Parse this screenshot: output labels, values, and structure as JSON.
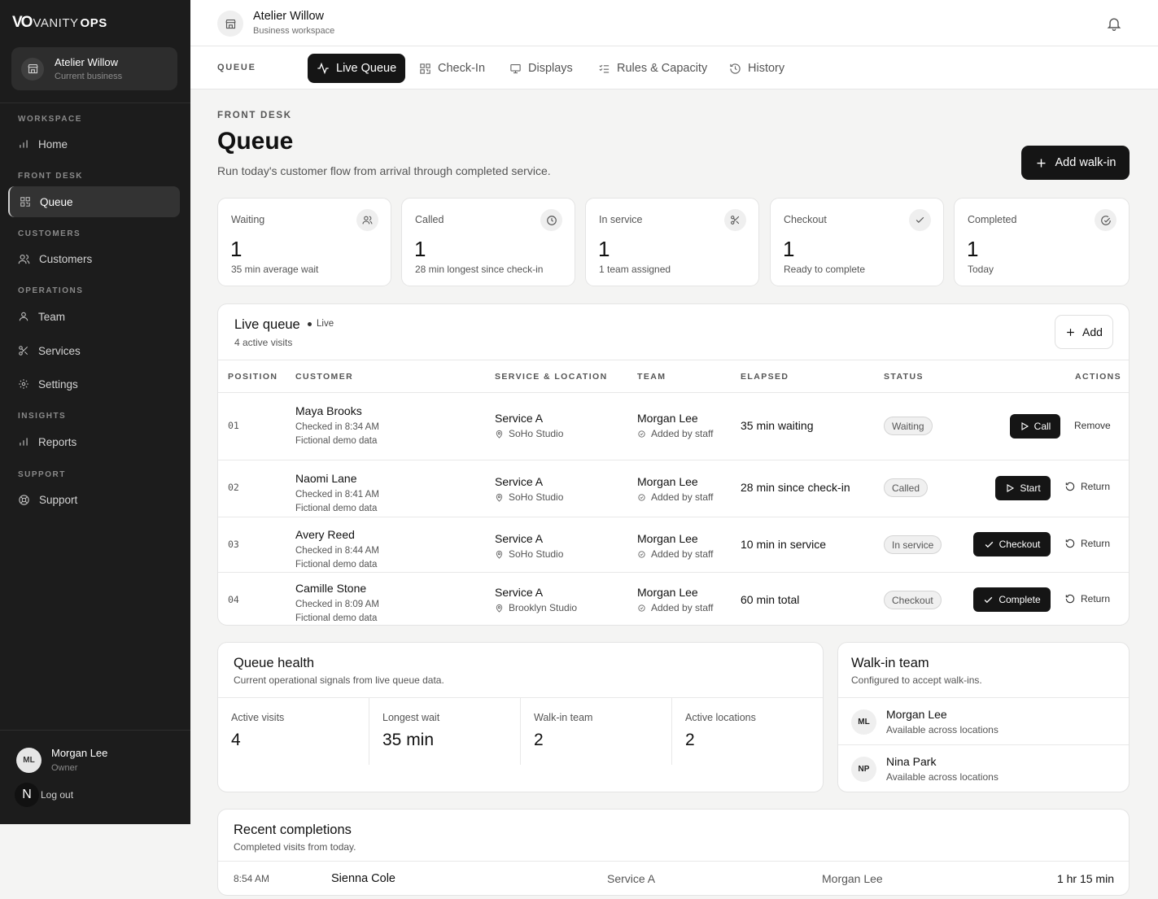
{
  "brand": {
    "logo_mark": "VO",
    "logo_vanity": "VANITY",
    "logo_ops": "OPS"
  },
  "sidebar": {
    "business_name": "Atelier Willow",
    "business_role": "Current business",
    "sections": {
      "workspace": "WORKSPACE",
      "front_desk": "FRONT DESK",
      "customers": "CUSTOMERS",
      "operations": "OPERATIONS",
      "insights": "INSIGHTS",
      "support": "SUPPORT"
    },
    "items": {
      "home": "Home",
      "queue": "Queue",
      "customers": "Customers",
      "team": "Team",
      "services": "Services",
      "settings": "Settings",
      "reports": "Reports",
      "support": "Support"
    },
    "user": {
      "initials": "ML",
      "name": "Morgan Lee",
      "role": "Owner"
    },
    "logout": {
      "badge": "N",
      "label": "Log out"
    }
  },
  "topbar": {
    "title": "Atelier Willow",
    "subtitle": "Business workspace"
  },
  "tabs": {
    "section_label": "QUEUE",
    "items": [
      "Live Queue",
      "Check-In",
      "Displays",
      "Rules & Capacity",
      "History"
    ]
  },
  "page": {
    "kicker": "FRONT DESK",
    "title": "Queue",
    "subtitle": "Run today's customer flow from arrival through completed service.",
    "add_walkin": "Add walk-in"
  },
  "stats": [
    {
      "label": "Waiting",
      "value": "1",
      "sub": "35 min average wait",
      "icon": "users-icon"
    },
    {
      "label": "Called",
      "value": "1",
      "sub": "28 min longest since check-in",
      "icon": "clock-icon"
    },
    {
      "label": "In service",
      "value": "1",
      "sub": "1 team assigned",
      "icon": "scissors-icon"
    },
    {
      "label": "Checkout",
      "value": "1",
      "sub": "Ready to complete",
      "icon": "check-icon"
    },
    {
      "label": "Completed",
      "value": "1",
      "sub": "Today",
      "icon": "check-circle-icon"
    }
  ],
  "live_queue": {
    "title": "Live queue",
    "live": "Live",
    "subtitle": "4 active visits",
    "add_label": "Add",
    "headers": [
      "POSITION",
      "CUSTOMER",
      "SERVICE & LOCATION",
      "TEAM",
      "ELAPSED",
      "STATUS",
      "ACTIONS"
    ],
    "rows": [
      {
        "position": "01",
        "name": "Maya Brooks",
        "checked": "Checked in 8:34 AM",
        "note": "Fictional demo data",
        "service": "Service A",
        "location": "SoHo Studio",
        "team": "Morgan Lee",
        "team_sub": "Added by staff",
        "elapsed": "35 min waiting",
        "status": "Waiting",
        "primary": "Call",
        "secondary": "Remove"
      },
      {
        "position": "02",
        "name": "Naomi Lane",
        "checked": "Checked in 8:41 AM",
        "note": "Fictional demo data",
        "service": "Service A",
        "location": "SoHo Studio",
        "team": "Morgan Lee",
        "team_sub": "Added by staff",
        "elapsed": "28 min since check-in",
        "status": "Called",
        "primary": "Start",
        "secondary": "Return"
      },
      {
        "position": "03",
        "name": "Avery Reed",
        "checked": "Checked in 8:44 AM",
        "note": "Fictional demo data",
        "service": "Service A",
        "location": "SoHo Studio",
        "team": "Morgan Lee",
        "team_sub": "Added by staff",
        "elapsed": "10 min in service",
        "status": "In service",
        "primary": "Checkout",
        "secondary": "Return"
      },
      {
        "position": "04",
        "name": "Camille Stone",
        "checked": "Checked in 8:09 AM",
        "note": "Fictional demo data",
        "service": "Service A",
        "location": "Brooklyn Studio",
        "team": "Morgan Lee",
        "team_sub": "Added by staff",
        "elapsed": "60 min total",
        "status": "Checkout",
        "primary": "Complete",
        "secondary": "Return"
      }
    ]
  },
  "queue_health": {
    "title": "Queue health",
    "subtitle": "Current operational signals from live queue data.",
    "metrics": [
      {
        "label": "Active visits",
        "value": "4"
      },
      {
        "label": "Longest wait",
        "value": "35 min"
      },
      {
        "label": "Walk-in team",
        "value": "2"
      },
      {
        "label": "Active locations",
        "value": "2"
      }
    ]
  },
  "walkin_team": {
    "title": "Walk-in team",
    "subtitle": "Configured to accept walk-ins.",
    "members": [
      {
        "initials": "ML",
        "name": "Morgan Lee",
        "sub": "Available across locations"
      },
      {
        "initials": "NP",
        "name": "Nina Park",
        "sub": "Available across locations"
      }
    ]
  },
  "recent_completions": {
    "title": "Recent completions",
    "subtitle": "Completed visits from today.",
    "rows": [
      {
        "time": "8:54 AM",
        "customer": "Sienna Cole",
        "service": "Service A",
        "team": "Morgan Lee",
        "duration": "1 hr 15 min"
      }
    ]
  },
  "colors": {
    "sidebar_bg": "#1c1c1c",
    "accent_dark": "#151515",
    "page_bg": "#f4f4f3"
  }
}
